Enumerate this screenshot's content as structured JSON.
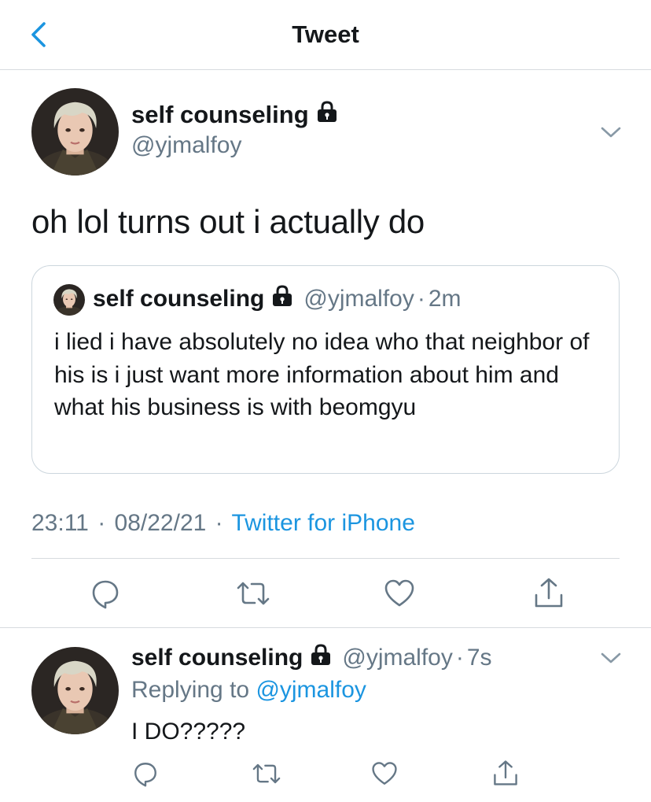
{
  "header": {
    "title": "Tweet",
    "back_icon": "chevron-left-icon"
  },
  "main_tweet": {
    "display_name": "self counseling",
    "handle": "@yjmalfoy",
    "lock_icon": "lock-icon",
    "text": "oh lol turns out i actually do",
    "quoted_tweet": {
      "display_name": "self counseling",
      "handle": "@yjmalfoy",
      "separator": "·",
      "time": "2m",
      "text": "i lied i have absolutely no idea who that neighbor of his is i just want more information about him and what his business is with beomgyu"
    },
    "time": "23:11",
    "separator": "·",
    "date": "08/22/21",
    "source": "Twitter for iPhone",
    "actions": [
      "reply-icon",
      "retweet-icon",
      "like-icon",
      "share-icon"
    ]
  },
  "reply_tweet": {
    "display_name": "self counseling",
    "handle": "@yjmalfoy",
    "separator": "·",
    "time": "7s",
    "replying_prefix": "Replying to",
    "replying_handle": "@yjmalfoy",
    "text": "I DO?????",
    "actions": [
      "reply-icon",
      "retweet-icon",
      "like-icon",
      "share-icon"
    ]
  },
  "colors": {
    "accent": "#1b95e0",
    "text": "#14171a",
    "muted": "#657786",
    "divider": "#d7dbdf"
  }
}
